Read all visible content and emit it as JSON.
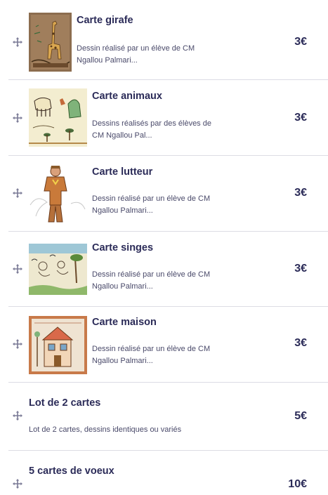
{
  "products": [
    {
      "title": "Carte girafe",
      "description": "Dessin réalisé par un élève de CM Ngallou Palmari...",
      "price": "3€",
      "thumb": "giraffe drawing"
    },
    {
      "title": "Carte animaux",
      "description": "Dessins réalisés par des élèves de CM Ngallou Pal...",
      "price": "3€",
      "thumb": "animals drawing"
    },
    {
      "title": "Carte lutteur",
      "description": "Dessin réalisé par un élève de CM Ngallou Palmari...",
      "price": "3€",
      "thumb": "wrestler drawing"
    },
    {
      "title": "Carte singes",
      "description": "Dessin réalisé par un élève de CM Ngallou Palmari...",
      "price": "3€",
      "thumb": "monkeys drawing"
    },
    {
      "title": "Carte maison",
      "description": "Dessin réalisé par un élève de CM Ngallou Palmari...",
      "price": "3€",
      "thumb": "house drawing"
    },
    {
      "title": "Lot de 2 cartes",
      "description": "Lot de 2 cartes, dessins identiques ou variés",
      "price": "5€"
    },
    {
      "title": "5 cartes de voeux",
      "description": "",
      "price": "10€"
    }
  ],
  "icons": {
    "drag": "drag-move-icon"
  },
  "colors": {
    "text": "#2b2b58",
    "divider": "#dcdce4",
    "muted": "#4a4a6a"
  }
}
